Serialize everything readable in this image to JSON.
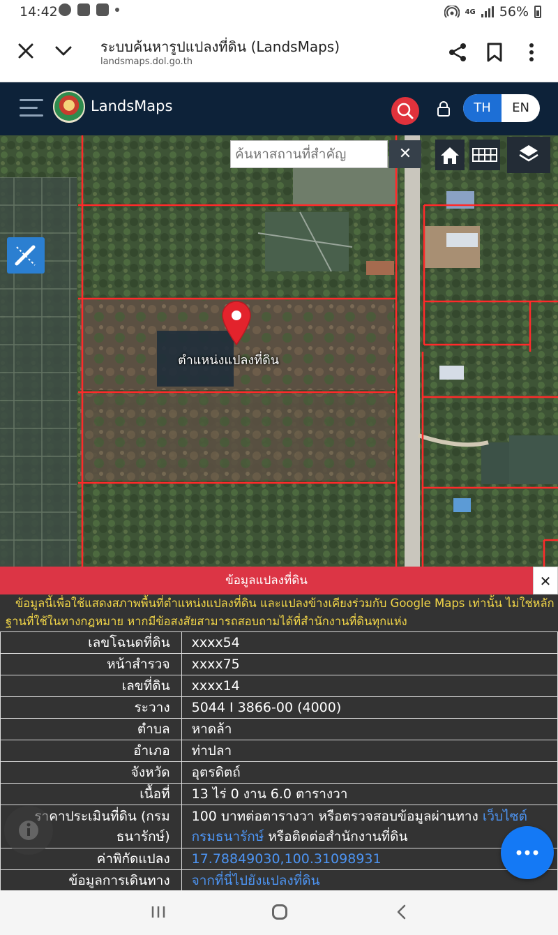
{
  "status_bar": {
    "time": "14:42",
    "network": "4G",
    "battery": "56%"
  },
  "browser": {
    "title": "ระบบค้นหารูปแปลงที่ดิน (LandsMaps)",
    "url": "landsmaps.dol.go.th"
  },
  "app": {
    "brand": "LandsMaps",
    "lang_th": "TH",
    "lang_en": "EN"
  },
  "map": {
    "search_placeholder": "ค้นหาสถานที่สำคัญ",
    "clear": "✕",
    "marker_label": "ตำแหน่งแปลงที่ดิน"
  },
  "panel": {
    "title": "ข้อมูลแปลงที่ดิน",
    "close": "✕",
    "disclaimer": "ข้อมูลนี้เพื่อใช้แสดงสภาพพื้นที่ตำแหน่งแปลงที่ดิน และแปลงข้างเคียงร่วมกับ Google Maps เท่านั้น ไม่ใช่หลักฐานที่ใช้ในทางกฎหมาย หากมีข้อสงสัยสามารถสอบถามได้ที่สำนักงานที่ดินทุกแห่ง",
    "rows": [
      {
        "label": "เลขโฉนดที่ดิน",
        "value": "xxxx54"
      },
      {
        "label": "หน้าสำรวจ",
        "value": "xxxx75"
      },
      {
        "label": "เลขที่ดิน",
        "value": "xxxx14"
      },
      {
        "label": "ระวาง",
        "value": "5044 I 3866-00 (4000)"
      },
      {
        "label": "ตำบล",
        "value": "หาดล้า"
      },
      {
        "label": "อำเภอ",
        "value": "ท่าปลา"
      },
      {
        "label": "จังหวัด",
        "value": "อุตรดิตถ์"
      },
      {
        "label": "เนื้อที่",
        "value": "13 ไร่ 0 งาน 6.0 ตารางวา"
      }
    ],
    "price": {
      "label": "ราคาประเมินที่ดิน (กรมธนารักษ์)",
      "text_before": "100 บาทต่อตารางวา หรือตรวจสอบข้อมูลผ่านทาง ",
      "link": "เว็บไซต์กรมธนารักษ์",
      "text_after": " หรือติดต่อสำนักงานที่ดิน"
    },
    "coords": {
      "label": "ค่าพิกัดแปลง",
      "value": "17.78849030,100.31098931"
    },
    "directions": {
      "label": "ข้อมูลการเดินทาง",
      "value": "จากที่นี่ไปยังแปลงที่ดิน"
    }
  },
  "colors": {
    "app_header": "#0d2239",
    "accent_red": "#dc3545",
    "link_blue": "#4d94f2",
    "disclaimer_yellow": "#f1d548",
    "fab_blue": "#1479f5"
  }
}
